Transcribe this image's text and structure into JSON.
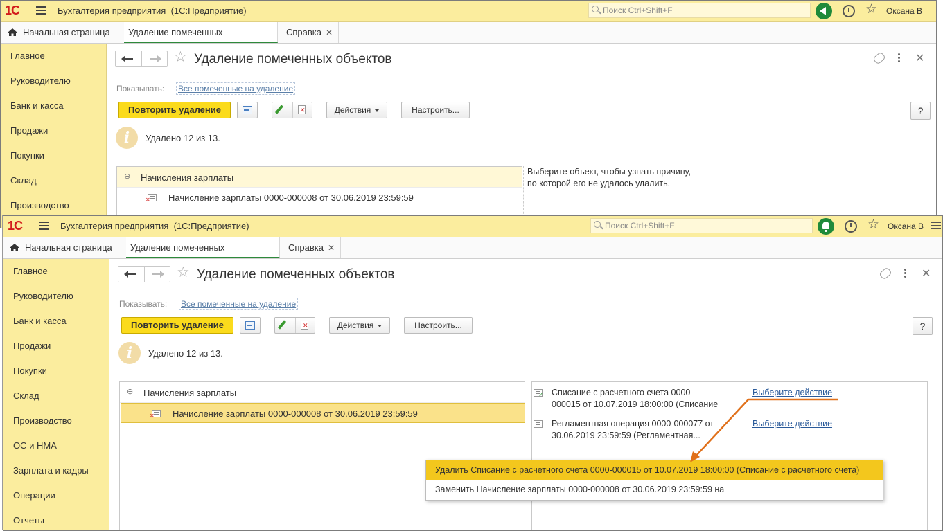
{
  "app": {
    "logo": "1С",
    "title": "Бухгалтерия предприятия",
    "subtitle": "(1С:Предприятие)",
    "search_placeholder": "Поиск Ctrl+Shift+F",
    "user": "Оксана В"
  },
  "tabs": [
    {
      "label": "Начальная страница"
    },
    {
      "label": "Удаление помеченных объектов"
    },
    {
      "label": "Справка"
    }
  ],
  "sidebar": {
    "items": [
      "Главное",
      "Руководителю",
      "Банк и касса",
      "Продажи",
      "Покупки",
      "Склад",
      "Производство",
      "ОС и НМА",
      "Зарплата и кадры",
      "Операции",
      "Отчеты"
    ]
  },
  "form": {
    "title": "Удаление помеченных объектов",
    "show_label": "Показывать:",
    "show_value": "Все помеченные на удаление",
    "retry_button": "Повторить удаление",
    "actions_button": "Действия",
    "settings_button": "Настроить...",
    "help_button": "?",
    "info_text": "Удалено 12 из 13."
  },
  "list": {
    "group": "Начисления зарплаты",
    "item": "Начисление зарплаты 0000-000008 от 30.06.2019 23:59:59"
  },
  "reason_hint": {
    "line1": "Выберите объект, чтобы узнать причину,",
    "line2": "по которой его не удалось удалить."
  },
  "right_panel": {
    "items": [
      {
        "text1": "Списание с расчетного счета 0000-",
        "text2": "000015 от 10.07.2019 18:00:00 (Списание",
        "link": "Выберите действие"
      },
      {
        "text1": "Регламентная операция 0000-000077 от",
        "text2": "30.06.2019 23:59:59 (Регламентная...",
        "link": "Выберите действие"
      }
    ]
  },
  "popup": {
    "options": [
      "Удалить Списание с расчетного счета 0000-000015 от 10.07.2019 18:00:00 (Списание с расчетного счета)",
      "Заменить Начисление зарплаты 0000-000008 от 30.06.2019 23:59:59 на"
    ]
  },
  "colors": {
    "accent_yellow": "#fbed9e",
    "primary_button": "#fbdb1c",
    "highlight": "#f3c71d",
    "annotation_arrow": "#e0701a",
    "status_green": "#1f8a3a"
  }
}
